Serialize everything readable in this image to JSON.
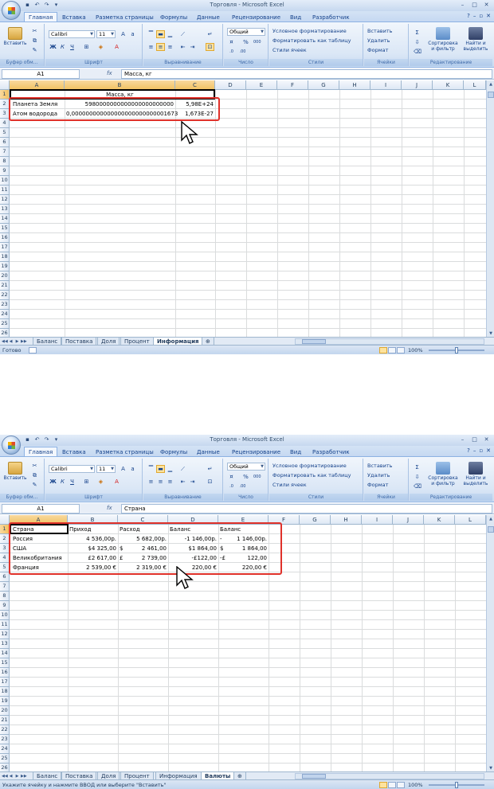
{
  "window1": {
    "title": "Торговля - Microsoft Excel",
    "tabs": [
      "Главная",
      "Вставка",
      "Разметка страницы",
      "Формулы",
      "Данные",
      "Рецензирование",
      "Вид",
      "Разработчик"
    ],
    "namebox": "A1",
    "formula": "Масса, кг",
    "columns": [
      "A",
      "B",
      "C",
      "D",
      "E",
      "F",
      "G",
      "H",
      "I",
      "J",
      "K",
      "L"
    ],
    "rows": [
      "1",
      "2",
      "3",
      "4",
      "5",
      "6",
      "7",
      "8",
      "9",
      "10",
      "11",
      "12",
      "13",
      "14",
      "15",
      "16",
      "17",
      "18",
      "19",
      "20",
      "21",
      "22",
      "23",
      "24",
      "25",
      "26"
    ],
    "cells": {
      "b1": "Масса, кг",
      "a2": "Планета Земля",
      "b2": "5980000000000000000000000",
      "c2": "5,98E+24",
      "a3": "Атом водорода",
      "b3": "0,000000000000000000000000001673",
      "c3": "1,673E-27"
    },
    "sheets": [
      "Баланс",
      "Поставка",
      "Доля",
      "Процент",
      "Информация"
    ],
    "active_sheet": "Информация",
    "status": "Готово",
    "zoom": "100%"
  },
  "window2": {
    "title": "Торговля - Microsoft Excel",
    "tabs": [
      "Главная",
      "Вставка",
      "Разметка страницы",
      "Формулы",
      "Данные",
      "Рецензирование",
      "Вид",
      "Разработчик"
    ],
    "namebox": "A1",
    "formula": "Страна",
    "columns": [
      "A",
      "B",
      "C",
      "D",
      "E",
      "F",
      "G",
      "H",
      "I",
      "J",
      "K",
      "L"
    ],
    "rows": [
      "1",
      "2",
      "3",
      "4",
      "5",
      "6",
      "7",
      "8",
      "9",
      "10",
      "11",
      "12",
      "13",
      "14",
      "15",
      "16",
      "17",
      "18",
      "19",
      "20",
      "21",
      "22",
      "23",
      "24",
      "25",
      "26"
    ],
    "table": {
      "headers": [
        "Страна",
        "Приход",
        "Расход",
        "Баланс",
        "Баланс"
      ],
      "rows": [
        [
          "Россия",
          "4 536,00р.",
          "5 682,00р.",
          "-1 146,00р.",
          "-",
          "1 146,00р."
        ],
        [
          "США",
          "$4 325,00",
          "$",
          "2 461,00",
          "$1 864,00",
          "$",
          "1 864,00"
        ],
        [
          "Великобритания",
          "£2 617,00",
          "£",
          "2 739,00",
          "-£122,00",
          "-£",
          "122,00"
        ],
        [
          "Франция",
          "2 539,00 €",
          "2 319,00 €",
          "220,00 €",
          "220,00 €"
        ]
      ]
    },
    "sheets": [
      "Баланс",
      "Поставка",
      "Доля",
      "Процент",
      "Информация",
      "Валюты"
    ],
    "active_sheet": "Валюты",
    "status": "Укажите ячейку и нажмите ВВОД или выберите \"Вставить\"",
    "zoom": "100%"
  },
  "ribbon": {
    "groups": [
      "Буфер обм...",
      "Шрифт",
      "Выравнивание",
      "Число",
      "Стили",
      "Ячейки",
      "Редактирование"
    ],
    "paste_label": "Вставить",
    "font_name": "Calibri",
    "font_size": "11",
    "number_format": "Общий",
    "bold": "Ж",
    "italic": "К",
    "underline": "Ч",
    "percent": "%",
    "thousands": "000",
    "styles": [
      "Условное форматирование",
      "Форматировать как таблицу",
      "Стили ячеек"
    ],
    "cells_cmds": [
      "Вставить",
      "Удалить",
      "Формат"
    ],
    "sort_label": [
      "Сортировка",
      "и фильтр"
    ],
    "find_label": [
      "Найти и",
      "выделить"
    ],
    "sigma": "Σ"
  },
  "colors": {
    "accent_frame": "#e0312a",
    "selection_header": "#f1c15f",
    "gridline": "#dadcdd"
  }
}
